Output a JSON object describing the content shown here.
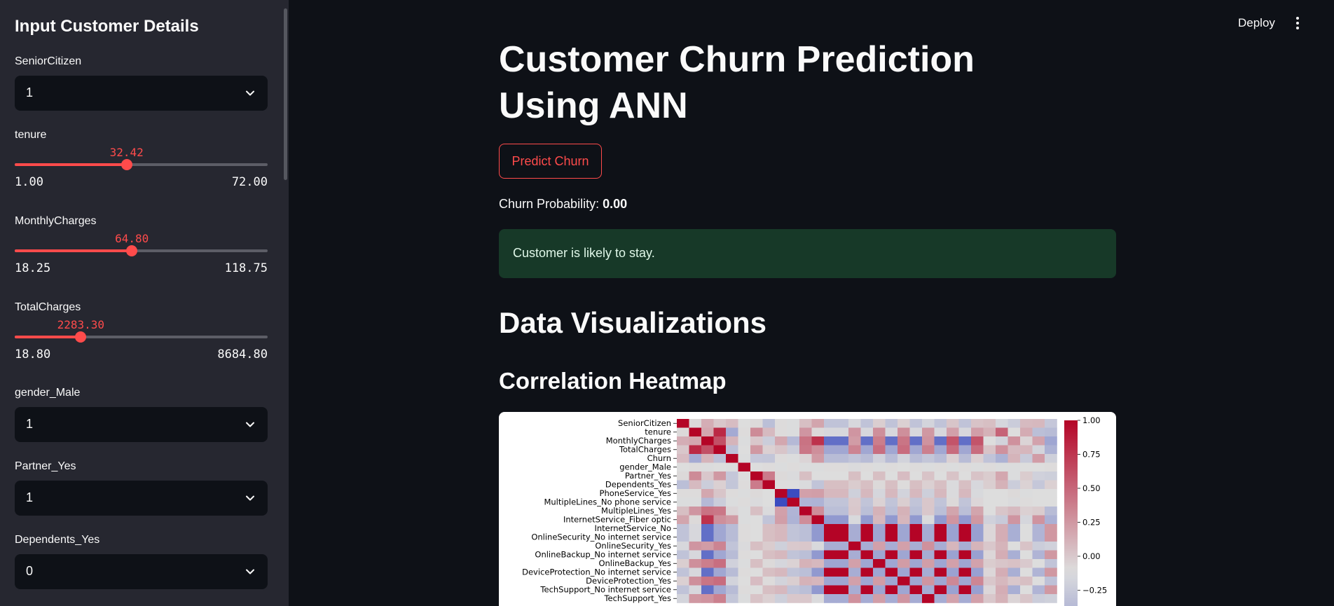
{
  "sidebar": {
    "title": "Input Customer Details",
    "senior_citizen": {
      "label": "SeniorCitizen",
      "value": "1"
    },
    "tenure": {
      "label": "tenure",
      "value": "32.42",
      "min": "1.00",
      "max": "72.00",
      "fraction": 0.4425
    },
    "monthly_charges": {
      "label": "MonthlyCharges",
      "value": "64.80",
      "min": "18.25",
      "max": "118.75",
      "fraction": 0.4632
    },
    "total_charges": {
      "label": "TotalCharges",
      "value": "2283.30",
      "min": "18.80",
      "max": "8684.80",
      "fraction": 0.2613
    },
    "gender_male": {
      "label": "gender_Male",
      "value": "1"
    },
    "partner_yes": {
      "label": "Partner_Yes",
      "value": "1"
    },
    "dependents_yes": {
      "label": "Dependents_Yes",
      "value": "0"
    }
  },
  "header": {
    "deploy_label": "Deploy",
    "menu_icon": "kebab-menu-icon"
  },
  "main": {
    "title": "Customer Churn Prediction Using ANN",
    "predict_button": "Predict Churn",
    "probability_label": "Churn Probability:",
    "probability_value": "0.00",
    "alert": "Customer is likely to stay.",
    "section_title": "Data Visualizations",
    "subsection_title": "Correlation Heatmap"
  },
  "colors": {
    "accent": "#ff4b4b",
    "success_bg": "#173928",
    "sidebar_bg": "#262730",
    "app_bg": "#0e1117"
  },
  "chart_data": {
    "type": "heatmap",
    "title": "",
    "row_labels": [
      "SeniorCitizen",
      "tenure",
      "MonthlyCharges",
      "TotalCharges",
      "Churn",
      "gender_Male",
      "Partner_Yes",
      "Dependents_Yes",
      "PhoneService_Yes",
      "MultipleLines_No phone service",
      "MultipleLines_Yes",
      "InternetService_Fiber optic",
      "InternetService_No",
      "OnlineSecurity_No internet service",
      "OnlineSecurity_Yes",
      "OnlineBackup_No internet service",
      "OnlineBackup_Yes",
      "DeviceProtection_No internet service",
      "DeviceProtection_Yes",
      "TechSupport_No internet service",
      "TechSupport_Yes"
    ],
    "colorbar_ticks": [
      "1.00",
      "0.75",
      "0.50",
      "0.25",
      "0.00",
      "−0.25"
    ],
    "colorbar_range": [
      -0.4,
      1.0
    ],
    "colormap": "coolwarm",
    "visible_rows": 21,
    "total_columns": 31,
    "matrix_rows": [
      [
        1.0,
        0.02,
        0.22,
        0.1,
        0.15,
        0.0,
        0.02,
        -0.21,
        0.01,
        -0.01,
        0.14,
        0.26,
        -0.18,
        -0.18,
        -0.04,
        -0.18,
        0.07,
        -0.18,
        0.06,
        -0.18,
        -0.06,
        -0.18,
        0.11,
        -0.18,
        0.12,
        0.14,
        -0.05,
        -0.12,
        0.16,
        0.17,
        -0.15
      ],
      [
        0.02,
        1.0,
        0.25,
        0.83,
        -0.35,
        0.01,
        0.38,
        0.16,
        0.01,
        -0.01,
        0.33,
        0.02,
        -0.04,
        -0.04,
        0.33,
        -0.04,
        0.36,
        -0.04,
        0.36,
        -0.04,
        0.32,
        -0.04,
        0.28,
        -0.04,
        0.29,
        0.2,
        0.56,
        0.0,
        0.23,
        -0.21,
        -0.23
      ],
      [
        0.22,
        0.25,
        1.0,
        0.65,
        0.19,
        -0.01,
        0.1,
        -0.11,
        0.25,
        -0.25,
        0.49,
        0.79,
        -0.76,
        -0.76,
        0.3,
        -0.76,
        0.44,
        -0.76,
        0.48,
        -0.76,
        0.34,
        -0.76,
        0.63,
        -0.76,
        0.63,
        0.0,
        -0.07,
        0.35,
        0.04,
        0.27,
        -0.38
      ],
      [
        0.1,
        0.83,
        0.65,
        1.0,
        -0.2,
        0.0,
        0.32,
        0.06,
        0.11,
        -0.11,
        0.47,
        0.36,
        -0.37,
        -0.37,
        0.41,
        -0.37,
        0.51,
        -0.37,
        0.52,
        -0.37,
        0.43,
        -0.37,
        0.52,
        -0.37,
        0.52,
        0.12,
        0.35,
        0.16,
        0.18,
        -0.06,
        -0.3
      ],
      [
        0.15,
        -0.35,
        0.19,
        -0.2,
        1.0,
        -0.01,
        -0.15,
        -0.16,
        0.01,
        -0.01,
        0.04,
        0.31,
        -0.23,
        -0.23,
        -0.17,
        -0.23,
        -0.08,
        -0.23,
        -0.07,
        -0.23,
        -0.16,
        -0.23,
        0.06,
        -0.23,
        0.06,
        -0.18,
        -0.3,
        0.19,
        -0.13,
        0.3,
        -0.09
      ],
      [
        0.0,
        0.01,
        -0.01,
        0.0,
        -0.01,
        1.0,
        0.0,
        0.01,
        -0.01,
        0.01,
        -0.01,
        -0.01,
        0.01,
        0.01,
        -0.02,
        0.01,
        -0.01,
        0.01,
        0.0,
        0.01,
        -0.01,
        0.01,
        -0.01,
        0.01,
        -0.01,
        0.01,
        -0.01,
        -0.01,
        0.0,
        0.0,
        0.01
      ],
      [
        0.02,
        0.38,
        0.1,
        0.32,
        -0.15,
        0.0,
        1.0,
        0.45,
        0.02,
        -0.02,
        0.14,
        0.0,
        0.0,
        0.0,
        0.14,
        0.0,
        0.14,
        0.0,
        0.15,
        0.0,
        0.12,
        0.0,
        0.12,
        0.0,
        0.12,
        0.08,
        0.25,
        -0.01,
        0.08,
        -0.08,
        -0.1
      ],
      [
        -0.21,
        0.16,
        -0.11,
        0.06,
        -0.16,
        0.01,
        0.45,
        1.0,
        0.0,
        0.0,
        -0.02,
        -0.17,
        0.14,
        0.14,
        0.08,
        0.14,
        0.02,
        0.14,
        0.01,
        0.14,
        0.06,
        0.14,
        -0.02,
        0.14,
        -0.04,
        0.07,
        0.2,
        -0.11,
        0.05,
        -0.15,
        0.06
      ],
      [
        0.01,
        0.01,
        0.25,
        0.11,
        0.01,
        -0.01,
        0.02,
        0.0,
        1.0,
        -1.0,
        0.28,
        0.29,
        0.17,
        0.17,
        -0.09,
        0.17,
        -0.05,
        0.17,
        -0.07,
        0.17,
        -0.1,
        0.17,
        -0.02,
        0.17,
        -0.03,
        0.0,
        0.0,
        0.02,
        -0.01,
        0.0,
        -0.0
      ],
      [
        -0.01,
        -0.01,
        -0.25,
        -0.11,
        -0.01,
        0.01,
        -0.02,
        0.0,
        -1.0,
        1.0,
        -0.28,
        -0.29,
        -0.17,
        -0.17,
        0.09,
        -0.17,
        0.05,
        -0.17,
        0.07,
        -0.17,
        0.1,
        -0.17,
        0.02,
        -0.17,
        0.03,
        0.0,
        0.0,
        -0.02,
        0.01,
        0.0,
        0.0
      ],
      [
        0.14,
        0.33,
        0.49,
        0.47,
        0.04,
        -0.01,
        0.14,
        -0.02,
        0.28,
        -0.28,
        1.0,
        0.37,
        -0.21,
        -0.21,
        0.1,
        -0.21,
        0.2,
        -0.21,
        0.2,
        -0.21,
        0.1,
        -0.21,
        0.26,
        -0.21,
        0.26,
        -0.0,
        0.11,
        0.16,
        0.06,
        0.08,
        -0.23
      ],
      [
        0.26,
        0.02,
        0.79,
        0.36,
        0.31,
        -0.01,
        0.0,
        -0.17,
        0.29,
        -0.29,
        0.37,
        1.0,
        -0.47,
        -0.47,
        -0.03,
        -0.47,
        0.17,
        -0.47,
        0.18,
        -0.47,
        -0.02,
        -0.47,
        0.33,
        -0.47,
        0.32,
        -0.08,
        -0.13,
        0.33,
        -0.05,
        0.34,
        -0.31
      ],
      [
        -0.18,
        -0.04,
        -0.76,
        -0.37,
        -0.23,
        0.01,
        0.0,
        0.14,
        0.17,
        -0.17,
        -0.21,
        -0.47,
        1.0,
        1.0,
        -0.33,
        1.0,
        -0.38,
        1.0,
        -0.38,
        1.0,
        -0.34,
        1.0,
        -0.41,
        1.0,
        -0.42,
        0.03,
        0.22,
        -0.32,
        0.0,
        -0.28,
        0.32
      ],
      [
        -0.18,
        -0.04,
        -0.76,
        -0.37,
        -0.23,
        0.01,
        0.0,
        0.14,
        0.17,
        -0.17,
        -0.21,
        -0.47,
        1.0,
        1.0,
        -0.33,
        1.0,
        -0.38,
        1.0,
        -0.38,
        1.0,
        -0.34,
        1.0,
        -0.41,
        1.0,
        -0.42,
        0.03,
        0.22,
        -0.32,
        0.0,
        -0.28,
        0.32
      ],
      [
        -0.04,
        0.33,
        0.3,
        0.41,
        -0.17,
        -0.02,
        0.14,
        0.08,
        -0.09,
        0.09,
        0.1,
        -0.03,
        -0.33,
        -0.33,
        1.0,
        -0.33,
        0.28,
        -0.33,
        0.28,
        -0.33,
        0.35,
        -0.33,
        0.18,
        -0.33,
        0.19,
        0.1,
        0.19,
        -0.0,
        0.12,
        -0.11,
        -0.08
      ],
      [
        -0.18,
        -0.04,
        -0.76,
        -0.37,
        -0.23,
        0.01,
        0.0,
        0.14,
        0.17,
        -0.17,
        -0.21,
        -0.47,
        1.0,
        1.0,
        -0.33,
        1.0,
        -0.38,
        1.0,
        -0.38,
        1.0,
        -0.34,
        1.0,
        -0.41,
        1.0,
        -0.42,
        0.03,
        0.22,
        -0.32,
        0.0,
        -0.28,
        0.32
      ],
      [
        0.07,
        0.36,
        0.44,
        0.51,
        -0.08,
        -0.01,
        0.14,
        0.02,
        -0.05,
        0.05,
        0.2,
        0.17,
        -0.38,
        -0.38,
        0.28,
        -0.38,
        1.0,
        -0.38,
        0.3,
        -0.38,
        0.29,
        -0.38,
        0.28,
        -0.38,
        0.27,
        0.08,
        0.11,
        0.13,
        0.09,
        -0.0,
        -0.17
      ],
      [
        -0.18,
        -0.04,
        -0.76,
        -0.37,
        -0.23,
        0.01,
        0.0,
        0.14,
        0.17,
        -0.17,
        -0.21,
        -0.47,
        1.0,
        1.0,
        -0.33,
        1.0,
        -0.38,
        1.0,
        -0.38,
        1.0,
        -0.34,
        1.0,
        -0.41,
        1.0,
        -0.42,
        0.03,
        0.22,
        -0.32,
        0.0,
        -0.28,
        0.32
      ],
      [
        0.06,
        0.36,
        0.48,
        0.52,
        -0.07,
        0.0,
        0.15,
        0.01,
        -0.07,
        0.07,
        0.2,
        0.18,
        -0.38,
        -0.38,
        0.28,
        -0.38,
        0.3,
        -0.38,
        1.0,
        -0.38,
        0.33,
        -0.38,
        0.39,
        -0.38,
        0.4,
        0.1,
        0.17,
        0.1,
        0.14,
        -0.0,
        -0.19
      ],
      [
        -0.18,
        -0.04,
        -0.76,
        -0.37,
        -0.23,
        0.01,
        0.0,
        0.14,
        0.17,
        -0.17,
        -0.21,
        -0.47,
        1.0,
        1.0,
        -0.33,
        1.0,
        -0.38,
        1.0,
        -0.38,
        1.0,
        -0.34,
        1.0,
        -0.41,
        1.0,
        -0.42,
        0.03,
        0.22,
        -0.32,
        0.0,
        -0.28,
        0.32
      ],
      [
        -0.06,
        0.32,
        0.34,
        0.43,
        -0.16,
        -0.01,
        0.12,
        0.06,
        -0.1,
        0.1,
        0.1,
        -0.02,
        -0.34,
        -0.34,
        0.35,
        -0.34,
        0.29,
        -0.34,
        0.33,
        -0.34,
        1.0,
        -0.34,
        0.27,
        -0.34,
        0.28,
        0.1,
        0.2,
        0.04,
        0.11,
        -0.11,
        -0.09
      ]
    ]
  }
}
